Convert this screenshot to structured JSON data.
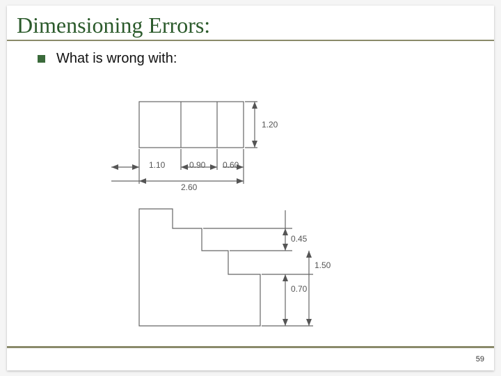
{
  "title": "Dimensioning Errors:",
  "bullet": "What is wrong with:",
  "page_number": "59",
  "dims": {
    "top_height": "1.20",
    "seg1": "1.10",
    "seg2": "0.90",
    "seg3": "0.60",
    "total_width": "2.60",
    "step1": "0.45",
    "step_total": "1.50",
    "step2": "0.70"
  }
}
